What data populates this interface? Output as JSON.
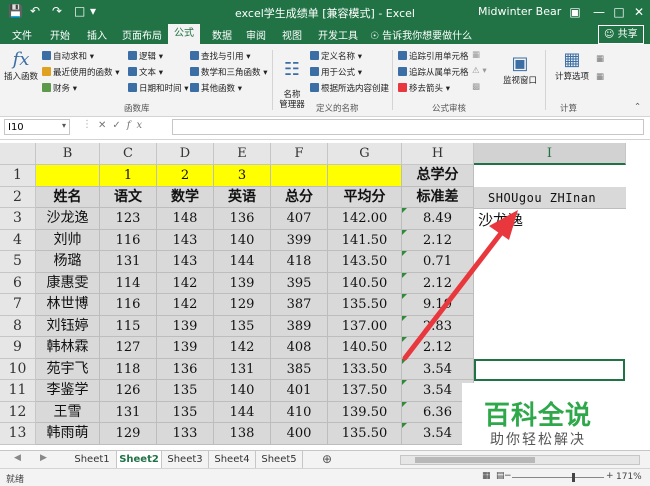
{
  "window": {
    "title": "excel学生成绩单 [兼容模式] - Excel",
    "user": "Midwinter Bear",
    "share": "共享",
    "tell_me": "告诉我你想要做什么"
  },
  "tabs": [
    "文件",
    "开始",
    "插入",
    "页面布局",
    "公式",
    "数据",
    "审阅",
    "视图",
    "开发工具"
  ],
  "active_tab": "公式",
  "ribbon": {
    "insert_function": "插入函数",
    "library": [
      "自动求和",
      "最近使用的函数",
      "财务",
      "逻辑",
      "文本",
      "日期和时间",
      "查找与引用",
      "数学和三角函数",
      "其他函数"
    ],
    "library_label": "函数库",
    "name_manager": "名称\n管理器",
    "names": [
      "定义名称",
      "用于公式",
      "根据所选内容创建"
    ],
    "names_label": "定义的名称",
    "audit": [
      "追踪引用单元格",
      "追踪从属单元格",
      "移去箭头"
    ],
    "audit_label": "公式审核",
    "watch": "监视窗口",
    "calc": "计算选项",
    "calc_label": "计算"
  },
  "formula_bar": {
    "name_box": "I10",
    "fx": "fx"
  },
  "columns": [
    "B",
    "C",
    "D",
    "E",
    "F",
    "G",
    "H",
    "I"
  ],
  "selected_column": "I",
  "rows": [
    "1",
    "2",
    "3",
    "4",
    "5",
    "6",
    "7",
    "8",
    "9",
    "10",
    "11",
    "12",
    "13"
  ],
  "row1": {
    "C": "1",
    "D": "2",
    "E": "3",
    "H": "总学分"
  },
  "headers": {
    "B": "姓名",
    "C": "语文",
    "D": "数学",
    "E": "英语",
    "F": "总分",
    "G": "平均分",
    "H": "标准差"
  },
  "cell_I2": "SHOUgou ZHInan",
  "cell_I3": "沙龙逸",
  "students": [
    {
      "name": "沙龙逸",
      "c": "123",
      "d": "148",
      "e": "136",
      "f": "407",
      "g": "142.00",
      "h": "8.49"
    },
    {
      "name": "刘帅",
      "c": "116",
      "d": "143",
      "e": "140",
      "f": "399",
      "g": "141.50",
      "h": "2.12"
    },
    {
      "name": "杨璐",
      "c": "131",
      "d": "143",
      "e": "144",
      "f": "418",
      "g": "143.50",
      "h": "0.71"
    },
    {
      "name": "康惠雯",
      "c": "114",
      "d": "142",
      "e": "139",
      "f": "395",
      "g": "140.50",
      "h": "2.12"
    },
    {
      "name": "林世博",
      "c": "116",
      "d": "142",
      "e": "129",
      "f": "387",
      "g": "135.50",
      "h": "9.19"
    },
    {
      "name": "刘钰婷",
      "c": "115",
      "d": "139",
      "e": "135",
      "f": "389",
      "g": "137.00",
      "h": "2.83"
    },
    {
      "name": "韩林霖",
      "c": "127",
      "d": "139",
      "e": "142",
      "f": "408",
      "g": "140.50",
      "h": "2.12"
    },
    {
      "name": "苑宇飞",
      "c": "118",
      "d": "136",
      "e": "131",
      "f": "385",
      "g": "133.50",
      "h": "3.54"
    },
    {
      "name": "李鉴学",
      "c": "126",
      "d": "135",
      "e": "140",
      "f": "401",
      "g": "137.50",
      "h": "3.54"
    },
    {
      "name": "王雪",
      "c": "131",
      "d": "135",
      "e": "144",
      "f": "410",
      "g": "139.50",
      "h": "6.36"
    },
    {
      "name": "韩雨萌",
      "c": "129",
      "d": "133",
      "e": "138",
      "f": "400",
      "g": "135.50",
      "h": "3.54"
    }
  ],
  "sheets": [
    "Sheet1",
    "Sheet2",
    "Sheet3",
    "Sheet4",
    "Sheet5"
  ],
  "active_sheet": "Sheet2",
  "status": {
    "ready": "就绪",
    "zoom": "171%"
  },
  "watermark": {
    "title": "百科全说",
    "subtitle": "助你轻松解决"
  },
  "colors": {
    "excel_green": "#217346",
    "arrow_red": "#e8383d",
    "highlight_yellow": "#ffff00",
    "cell_gray": "#d9d9d9"
  }
}
